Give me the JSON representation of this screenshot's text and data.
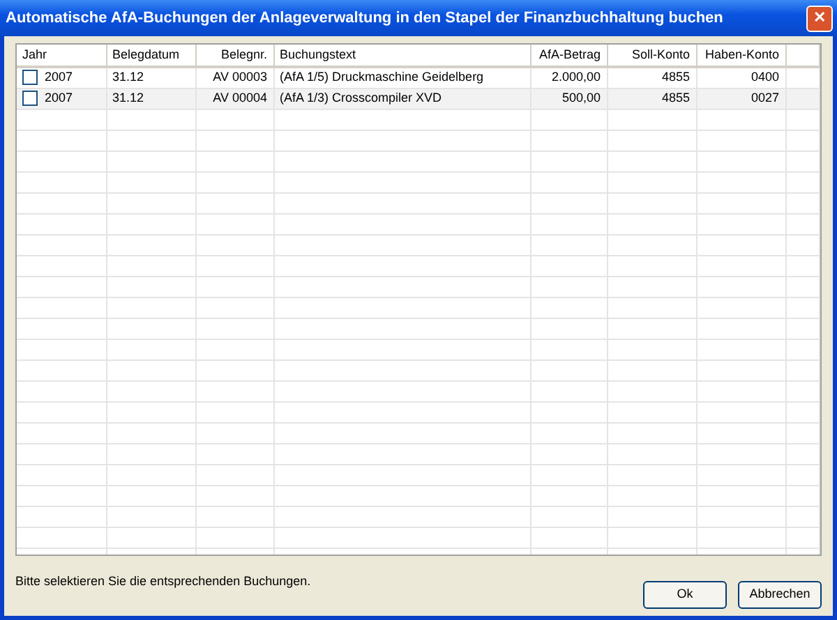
{
  "window": {
    "title": "Automatische AfA-Buchungen der Anlageverwaltung in den Stapel der Finanzbuchhaltung buchen",
    "close": "✕"
  },
  "table": {
    "columns": [
      "Jahr",
      "Belegdatum",
      "Belegnr.",
      "Buchungstext",
      "AfA-Betrag",
      "Soll-Konto",
      "Haben-Konto"
    ],
    "rows": [
      {
        "checked": false,
        "cells": [
          "2007",
          "31.12",
          "AV 00003",
          "(AfA 1/5) Druckmaschine Geidelberg",
          "2.000,00",
          "4855",
          "0400"
        ]
      },
      {
        "checked": false,
        "cells": [
          "2007",
          "31.12",
          "AV 00004",
          "(AfA 1/3) Crosscompiler XVD",
          "500,00",
          "4855",
          "0027"
        ]
      }
    ]
  },
  "hint": "Bitte selektieren Sie die entsprechenden Buchungen.",
  "buttons": [
    "Ok",
    "Abbrechen"
  ]
}
